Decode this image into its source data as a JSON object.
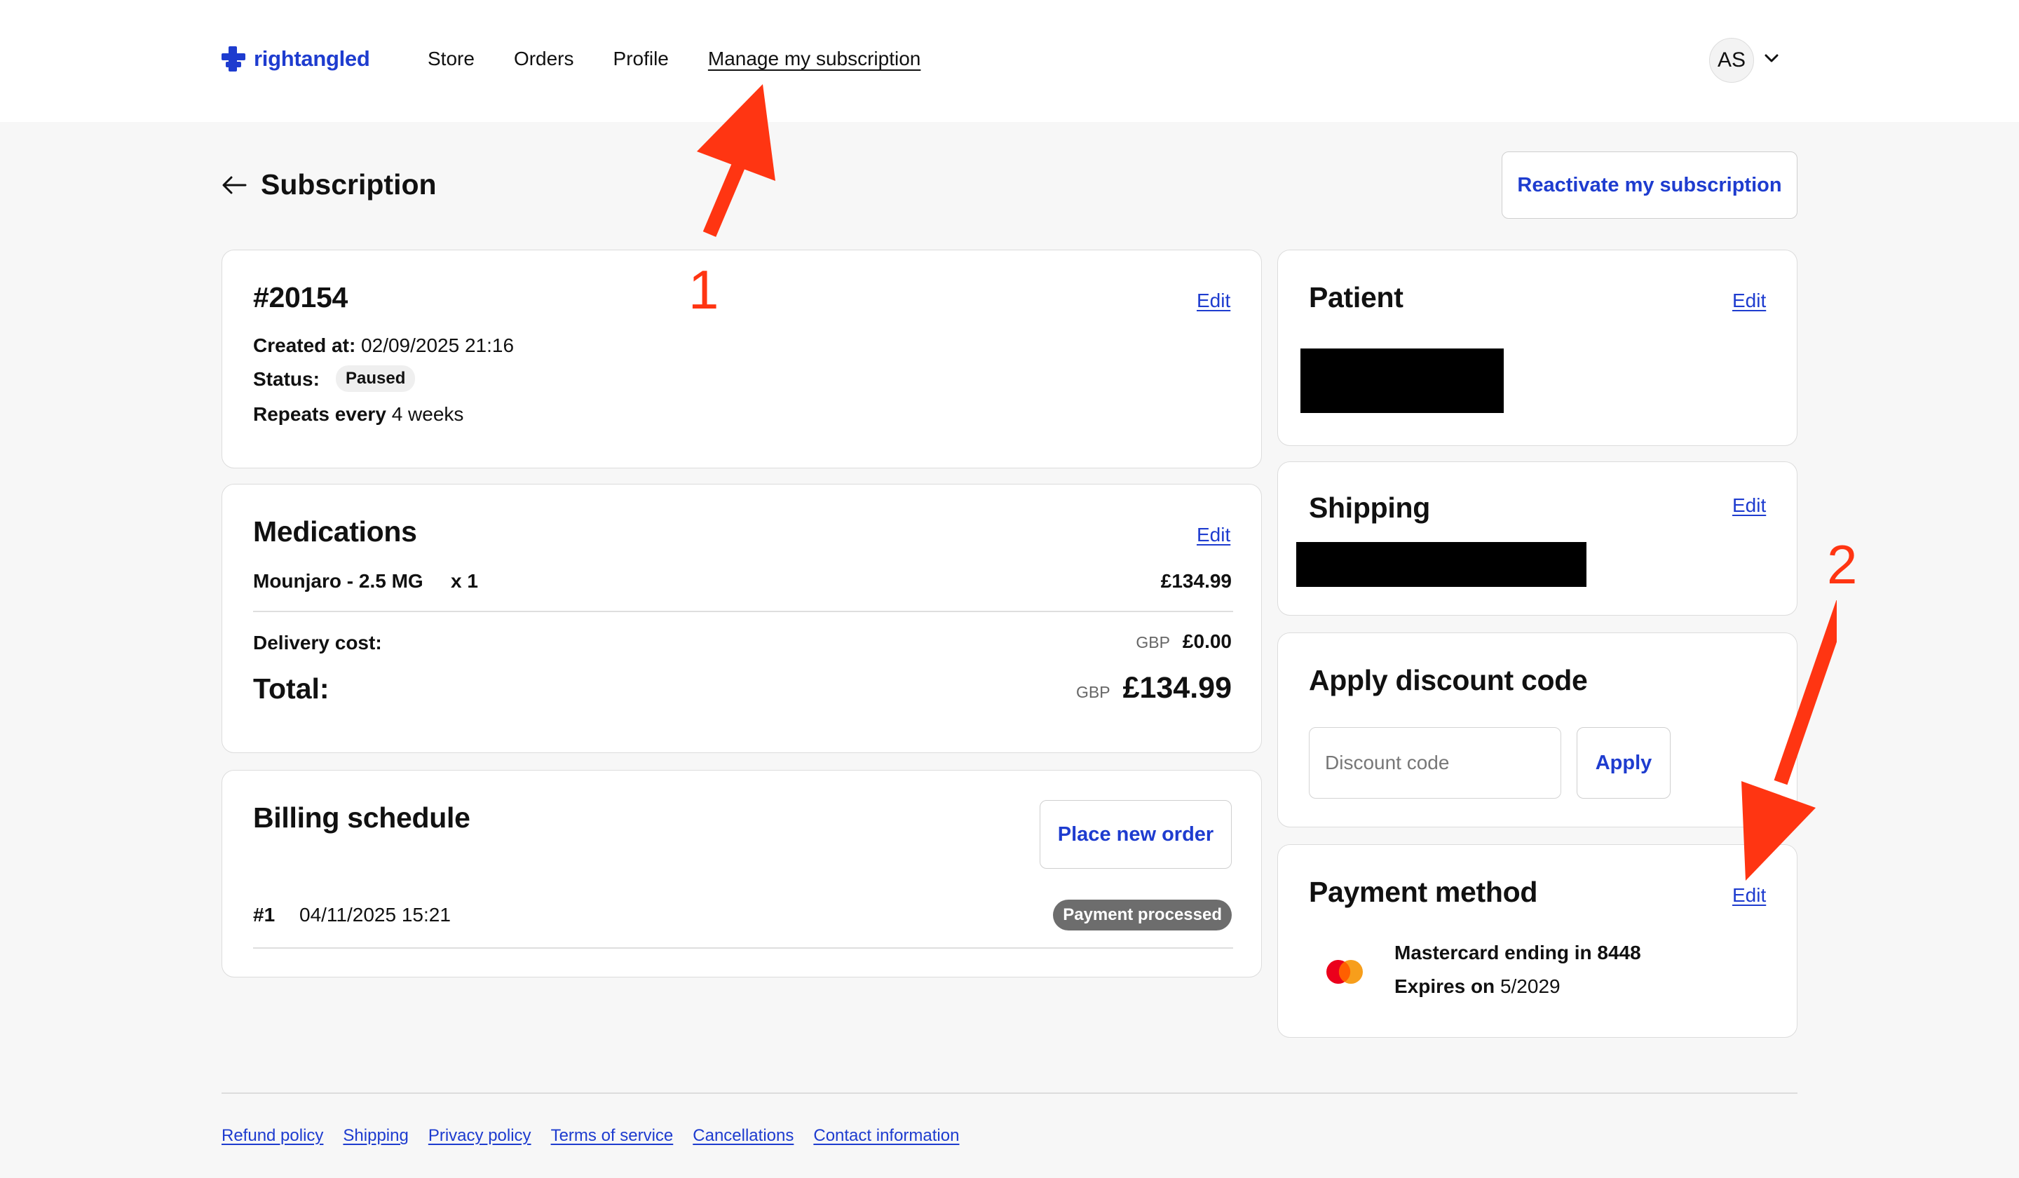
{
  "brand": {
    "name": "rightangled",
    "color": "#1e3ccf"
  },
  "nav": {
    "items": [
      "Store",
      "Orders",
      "Profile",
      "Manage my subscription"
    ],
    "active": "Manage my subscription"
  },
  "user": {
    "initials": "AS"
  },
  "page": {
    "title": "Subscription",
    "reactivate_label": "Reactivate my subscription"
  },
  "subscription": {
    "number": "#20154",
    "edit": "Edit",
    "created_label": "Created at:",
    "created_value": "02/09/2025 21:16",
    "status_label": "Status:",
    "status_value": "Paused",
    "repeats_label": "Repeats every",
    "repeats_value": "4 weeks"
  },
  "medications": {
    "title": "Medications",
    "edit": "Edit",
    "item_name": "Mounjaro - 2.5 MG",
    "item_qty": "x 1",
    "item_price": "£134.99",
    "delivery_label": "Delivery cost:",
    "delivery_currency": "GBP",
    "delivery_value": "£0.00",
    "total_label": "Total:",
    "total_currency": "GBP",
    "total_value": "£134.99"
  },
  "billing": {
    "title": "Billing schedule",
    "place_order_label": "Place new order",
    "rows": [
      {
        "index": "#1",
        "datetime": "04/11/2025 15:21",
        "status": "Payment processed"
      }
    ]
  },
  "patient": {
    "title": "Patient",
    "edit": "Edit"
  },
  "shipping": {
    "title": "Shipping",
    "edit": "Edit"
  },
  "discount": {
    "title": "Apply discount code",
    "placeholder": "Discount code",
    "apply_label": "Apply"
  },
  "payment": {
    "title": "Payment method",
    "edit": "Edit",
    "card_line": "Mastercard ending in 8448",
    "expires_label": "Expires on",
    "expires_value": "5/2029"
  },
  "footer": {
    "links": [
      "Refund policy",
      "Shipping",
      "Privacy policy",
      "Terms of service",
      "Cancellations",
      "Contact information"
    ]
  },
  "annotations": {
    "label_1": "1",
    "label_2": "2",
    "color": "#ff3512"
  }
}
